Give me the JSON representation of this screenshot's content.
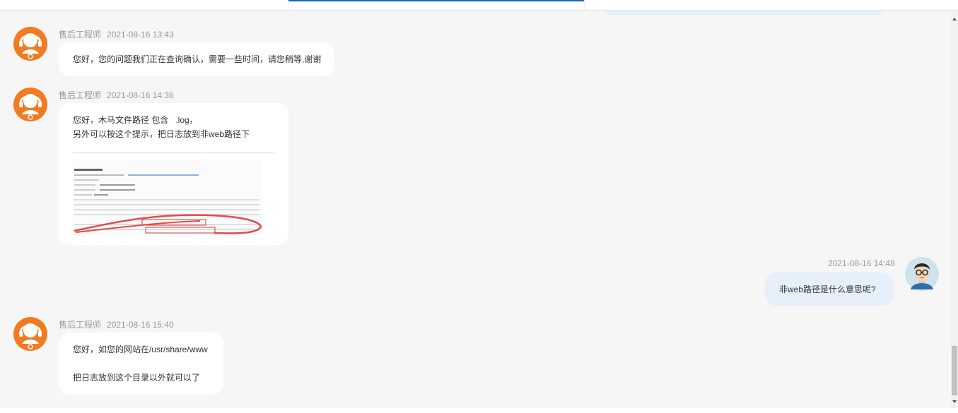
{
  "messages": [
    {
      "sender": "售后工程师",
      "time": "2021-08-16 13:43",
      "lines": [
        "您好，您的问题我们正在查询确认，需要一些时间，请您稍等,谢谢"
      ]
    },
    {
      "sender": "售后工程师",
      "time": "2021-08-16 14:36",
      "lines": [
        "您好，木马文件路径 包含   .log，",
        "另外可以按这个提示，把日志放到非web路径下"
      ]
    },
    {
      "time": "2021-08-16 14:48",
      "lines": [
        "非web路径是什么意思呢?"
      ]
    },
    {
      "sender": "售后工程师",
      "time": "2021-08-16 15:40",
      "lines": [
        "您好，如您的网站在/usr/share/www",
        "",
        "把日志放到这个目录以外就可以了"
      ]
    }
  ],
  "colors": {
    "agent_avatar": "#f47a20",
    "user_bubble": "#e6f0fb",
    "chat_background": "#f6f6f6",
    "active_tab": "#1466c9"
  },
  "icons": {
    "agent_avatar": "headset-agent-avatar",
    "user_avatar": "user-glasses-avatar"
  }
}
